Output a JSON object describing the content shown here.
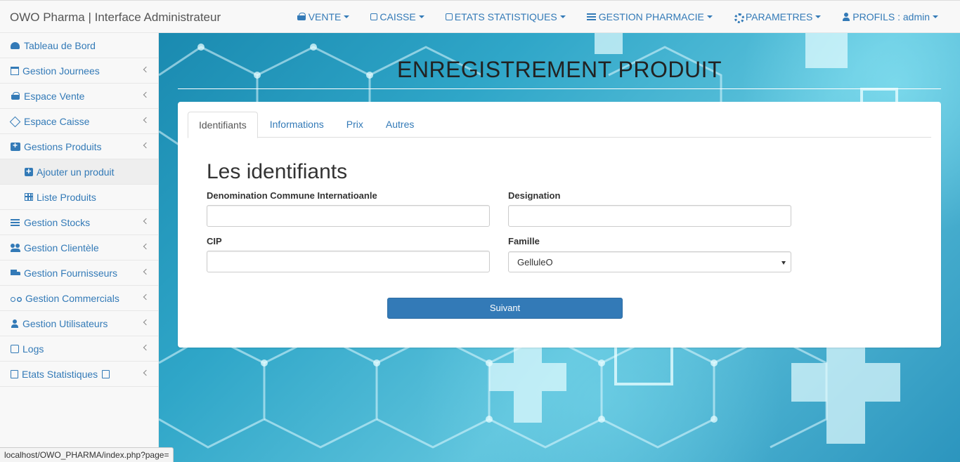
{
  "app": {
    "title": "OWO Pharma | Interface Administrateur"
  },
  "topnav": {
    "items": [
      {
        "label": "VENTE",
        "icon": "basket-icon"
      },
      {
        "label": "CAISSE",
        "icon": "register-icon"
      },
      {
        "label": "ETATS STATISTIQUES",
        "icon": "stats-icon"
      },
      {
        "label": "GESTION PHARMACIE",
        "icon": "list-icon"
      },
      {
        "label": "PARAMETRES",
        "icon": "gears-icon"
      },
      {
        "label": "PROFILS : admin",
        "icon": "user-icon"
      }
    ]
  },
  "sidebar": {
    "items": [
      {
        "label": "Tableau de Bord",
        "icon": "dashboard-icon"
      },
      {
        "label": "Gestion Journees",
        "icon": "calendar-icon"
      },
      {
        "label": "Espace Vente",
        "icon": "basket-icon"
      },
      {
        "label": "Espace Caisse",
        "icon": "diamond-icon"
      },
      {
        "label": "Gestions Produits",
        "icon": "medkit-icon"
      },
      {
        "label": "Ajouter un produit",
        "icon": "plus-square-icon"
      },
      {
        "label": "Liste Produits",
        "icon": "table-icon"
      },
      {
        "label": "Gestion Stocks",
        "icon": "list-icon"
      },
      {
        "label": "Gestion Clientèle",
        "icon": "users-icon"
      },
      {
        "label": "Gestion Fournisseurs",
        "icon": "truck-icon"
      },
      {
        "label": "Gestion Commercials",
        "icon": "motorcycle-icon"
      },
      {
        "label": "Gestion Utilisateurs",
        "icon": "user-icon"
      },
      {
        "label": "Logs",
        "icon": "clone-icon"
      },
      {
        "label": "Etats Statistiques",
        "icon": "file-excel-icon"
      }
    ]
  },
  "page": {
    "title": "ENREGISTREMENT PRODUIT",
    "tabs": [
      "Identifiants",
      "Informations",
      "Prix",
      "Autres"
    ],
    "active_tab": "Identifiants",
    "section_title": "Les identifiants"
  },
  "form": {
    "dci_label": "Denomination Commune Internatioanle",
    "dci_value": "",
    "designation_label": "Designation",
    "designation_value": "",
    "cip_label": "CIP",
    "cip_value": "",
    "famille_label": "Famille",
    "famille_value": "GelluleO",
    "submit_label": "Suivant"
  },
  "statusbar": {
    "url": "localhost/OWO_PHARMA/index.php?page="
  },
  "colors": {
    "link": "#337ab7",
    "primary_button": "#337ab7",
    "navbar_bg": "#f8f8f8"
  }
}
